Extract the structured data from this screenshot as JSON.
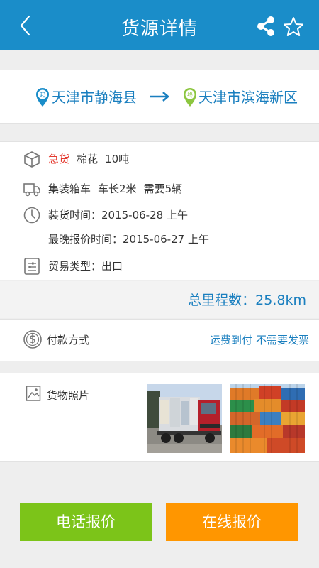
{
  "header": {
    "title": "货源详情"
  },
  "route": {
    "start_badge": "起",
    "start": "天津市静海县",
    "end_badge": "终",
    "end": "天津市滨海新区"
  },
  "cargo": {
    "urgency": "急货",
    "name": "棉花",
    "weight": "10吨"
  },
  "vehicle": {
    "type": "集装箱车",
    "length": "车长2米",
    "count": "需要5辆"
  },
  "time": {
    "loading": "装货时间：2015-06-28 上午",
    "latest_quote": "最晚报价时间：2015-06-27 上午"
  },
  "trade": {
    "type": "贸易类型：出口"
  },
  "distance": {
    "text": "总里程数：25.8km"
  },
  "payment": {
    "label": "付款方式",
    "method": "运费到付",
    "invoice": "不需要发票"
  },
  "photos": {
    "label": "货物照片"
  },
  "actions": {
    "phone_quote": "电话报价",
    "online_quote": "在线报价"
  },
  "colors": {
    "primary": "#1a8dc9",
    "link": "#1a7fbf",
    "urgent": "#e43a2f",
    "phone_button": "#7cc419",
    "online_button": "#ff9600"
  }
}
